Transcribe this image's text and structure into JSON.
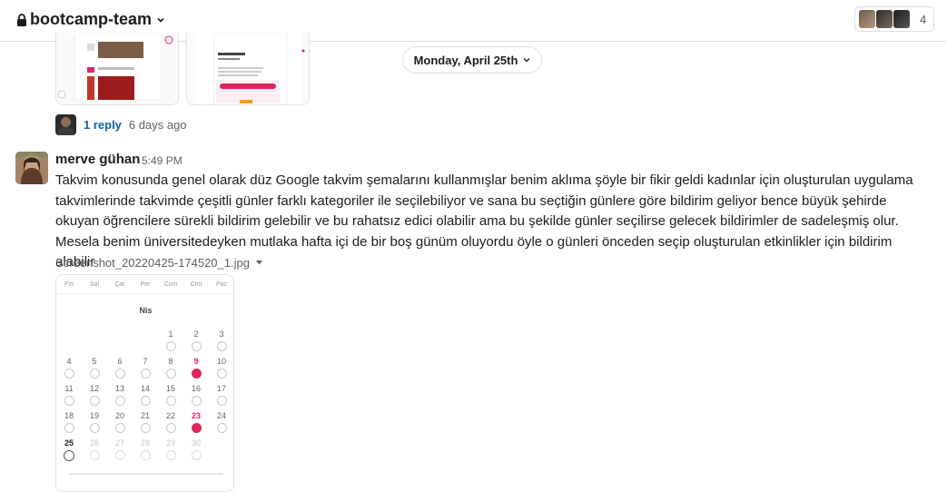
{
  "header": {
    "channel_name": "bootcamp-team",
    "member_count": "4"
  },
  "date_divider": {
    "label": "Monday, April 25th"
  },
  "previous_message": {
    "reply_count": "1 reply",
    "reply_time": "6 days ago"
  },
  "message": {
    "author": "merve gühan",
    "time": "5:49 PM",
    "text": "Takvim konusunda genel olarak düz Google takvim şemalarını kullanmışlar benim aklıma şöyle bir fikir geldi kadınlar için oluşturulan uygulama takvimlerinde takvimde çeşitli günler farklı kategoriler ile seçilebiliyor ve sana bu seçtiğin günlere göre bildirim geliyor bence büyük şehirde okuyan öğrencilere sürekli bildirim gelebilir ve bu rahatsız edici olabilir ama bu şekilde günler seçilirse gelecek bildirimler de sadeleşmiş olur. Mesela benim üniversitedeyken mutlaka hafta içi de bir boş günüm oluyordu öyle o günleri önceden seçip oluşturulan etkinlikler için bildirim alabilir",
    "attachment": {
      "filename": "Screenshot_20220425-174520_1.jpg",
      "calendar": {
        "weekdays": [
          "Pzt",
          "Sal",
          "Çar",
          "Per",
          "Cum",
          "Cmt",
          "Paz"
        ],
        "month": "Nis",
        "days": [
          [
            "",
            "",
            "",
            "",
            "1",
            "2",
            "3"
          ],
          [
            "4",
            "5",
            "6",
            "7",
            "8",
            "9",
            "10"
          ],
          [
            "11",
            "12",
            "13",
            "14",
            "15",
            "16",
            "17"
          ],
          [
            "18",
            "19",
            "20",
            "21",
            "22",
            "23",
            "24"
          ],
          [
            "25",
            "26",
            "27",
            "28",
            "29",
            "30",
            ""
          ]
        ],
        "marked_days": [
          "9",
          "23"
        ],
        "today": "25",
        "colors": {
          "marked": "#e0245e"
        }
      }
    }
  },
  "colors": {
    "link": "#1264a3",
    "muted": "#616061"
  },
  "icons": [
    "lock-icon",
    "chevron-down-icon",
    "caret-down-icon"
  ]
}
